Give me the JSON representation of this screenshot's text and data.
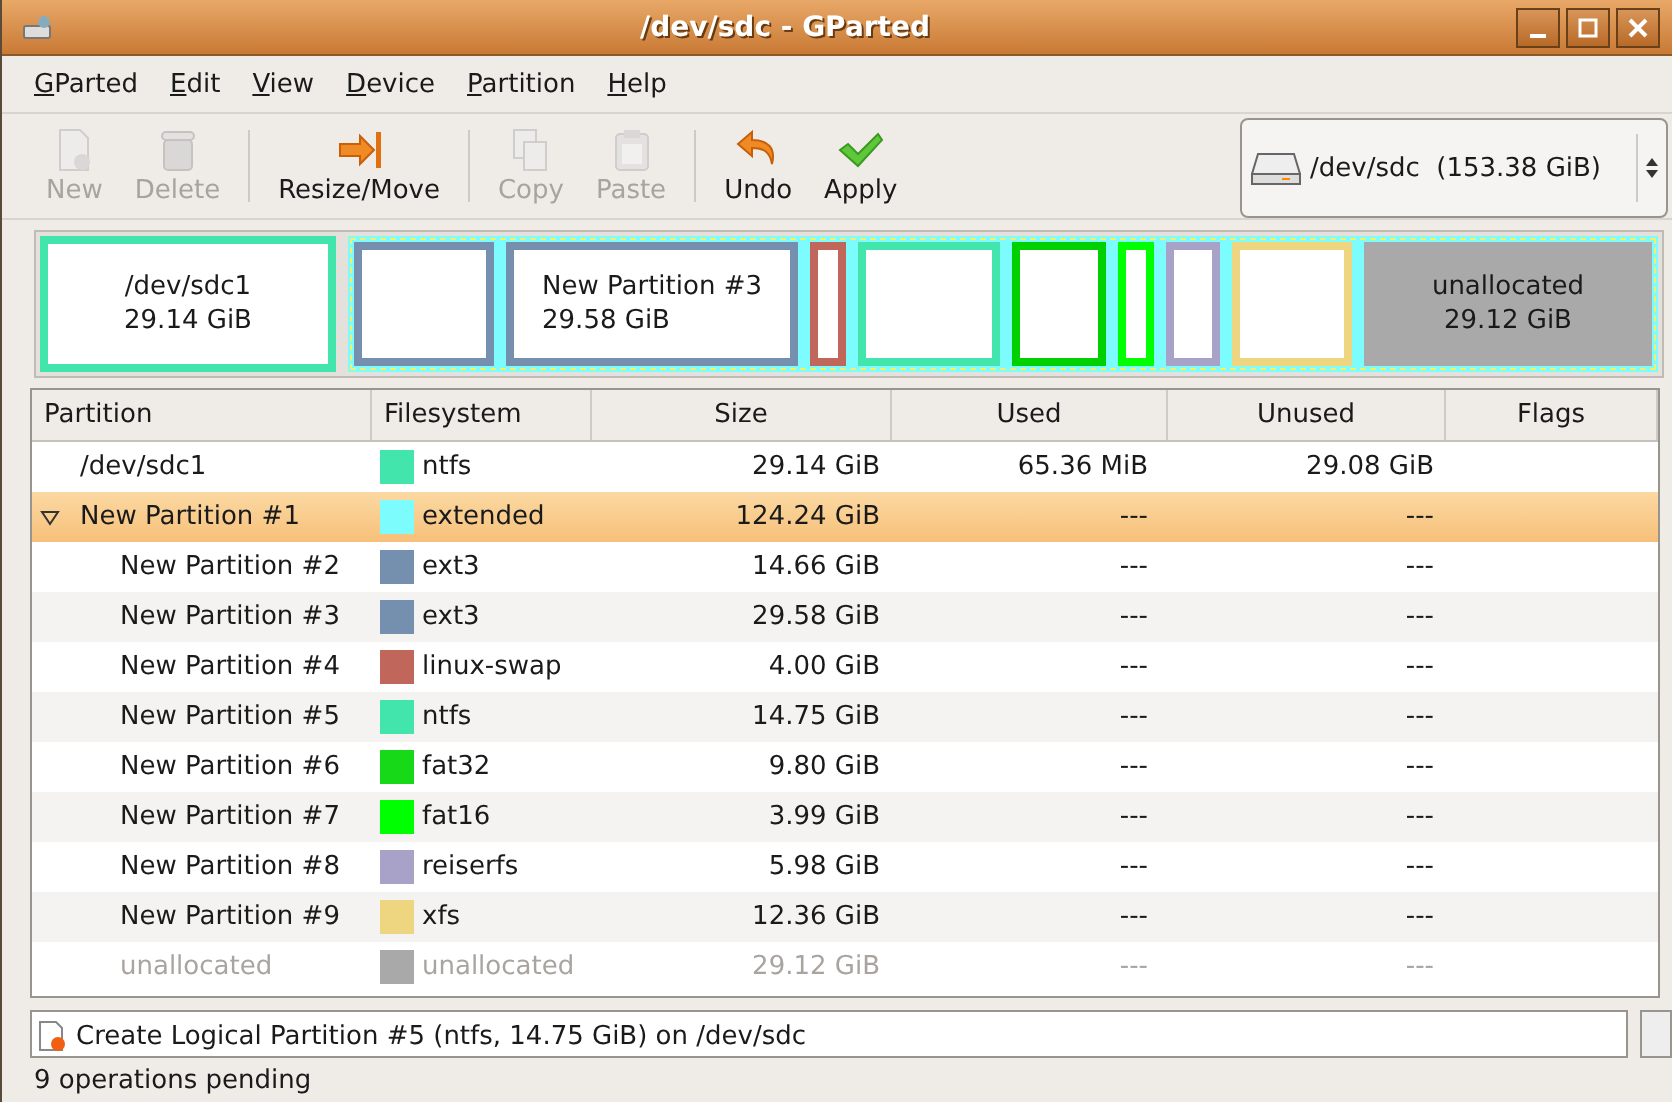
{
  "window": {
    "title": "/dev/sdc - GParted"
  },
  "menu": [
    "GParted",
    "Edit",
    "View",
    "Device",
    "Partition",
    "Help"
  ],
  "toolbar": [
    {
      "kind": "button",
      "label": "New",
      "disabled": true
    },
    {
      "kind": "button",
      "label": "Delete",
      "disabled": true
    },
    {
      "kind": "separator"
    },
    {
      "kind": "button",
      "label": "Resize/Move",
      "disabled": false
    },
    {
      "kind": "separator"
    },
    {
      "kind": "button",
      "label": "Copy",
      "disabled": true
    },
    {
      "kind": "button",
      "label": "Paste",
      "disabled": true
    },
    {
      "kind": "separator"
    },
    {
      "kind": "button",
      "label": "Undo",
      "disabled": false
    },
    {
      "kind": "button",
      "label": "Apply",
      "disabled": false
    }
  ],
  "device": {
    "name": "/dev/sdc",
    "size": "(153.38 GiB)"
  },
  "map": [
    {
      "kind": "partition",
      "label": "/dev/sdc1",
      "size": "29.14 GiB",
      "color": "#42e5ac"
    },
    {
      "kind": "extended",
      "color": "#7dfcfe",
      "children": [
        {
          "kind": "partition",
          "color": "#7590ae"
        },
        {
          "kind": "partition",
          "label": "New Partition #3",
          "size": "29.58 GiB",
          "color": "#7590ae"
        },
        {
          "kind": "partition",
          "color": "#c1665a"
        },
        {
          "kind": "partition",
          "color": "#42e5ac"
        },
        {
          "kind": "partition",
          "color": "#00d000"
        },
        {
          "kind": "partition",
          "color": "#00ff00"
        },
        {
          "kind": "partition",
          "color": "#a8a2c8"
        },
        {
          "kind": "partition",
          "color": "#eed680"
        },
        {
          "kind": "unallocated",
          "label": "unallocated",
          "size": "29.12 GiB",
          "color": "#a9a9a9"
        }
      ]
    }
  ],
  "table": {
    "columns": [
      "Partition",
      "Filesystem",
      "Size",
      "Used",
      "Unused",
      "Flags"
    ],
    "rows": [
      {
        "partition": "/dev/sdc1",
        "filesystem": "ntfs",
        "color": "#42e5ac",
        "size": "29.14 GiB",
        "used": "65.36 MiB",
        "unused": "29.08 GiB",
        "selected": false,
        "dimmed": false
      },
      {
        "partition": "New Partition #1",
        "filesystem": "extended",
        "color": "#7dfcfe",
        "size": "124.24 GiB",
        "used": "---",
        "unused": "---",
        "selected": true,
        "dimmed": false,
        "expanded": true,
        "children": [
          {
            "partition": "New Partition #2",
            "filesystem": "ext3",
            "color": "#7590ae",
            "size": "14.66 GiB",
            "used": "---",
            "unused": "---",
            "selected": false,
            "dimmed": false
          },
          {
            "partition": "New Partition #3",
            "filesystem": "ext3",
            "color": "#7590ae",
            "size": "29.58 GiB",
            "used": "---",
            "unused": "---",
            "selected": false,
            "dimmed": false
          },
          {
            "partition": "New Partition #4",
            "filesystem": "linux-swap",
            "color": "#c1665a",
            "size": "4.00 GiB",
            "used": "---",
            "unused": "---",
            "selected": false,
            "dimmed": false
          },
          {
            "partition": "New Partition #5",
            "filesystem": "ntfs",
            "color": "#42e5ac",
            "size": "14.75 GiB",
            "used": "---",
            "unused": "---",
            "selected": false,
            "dimmed": false
          },
          {
            "partition": "New Partition #6",
            "filesystem": "fat32",
            "color": "#18d918",
            "size": "9.80 GiB",
            "used": "---",
            "unused": "---",
            "selected": false,
            "dimmed": false
          },
          {
            "partition": "New Partition #7",
            "filesystem": "fat16",
            "color": "#00ff00",
            "size": "3.99 GiB",
            "used": "---",
            "unused": "---",
            "selected": false,
            "dimmed": false
          },
          {
            "partition": "New Partition #8",
            "filesystem": "reiserfs",
            "color": "#a8a2c8",
            "size": "5.98 GiB",
            "used": "---",
            "unused": "---",
            "selected": false,
            "dimmed": false
          },
          {
            "partition": "New Partition #9",
            "filesystem": "xfs",
            "color": "#eed680",
            "size": "12.36 GiB",
            "used": "---",
            "unused": "---",
            "selected": false,
            "dimmed": false
          },
          {
            "partition": "unallocated",
            "filesystem": "unallocated",
            "color": "#a9a9a9",
            "size": "29.12 GiB",
            "used": "---",
            "unused": "---",
            "selected": false,
            "dimmed": true
          }
        ]
      }
    ]
  },
  "operations": [
    "Create Logical Partition #5 (ntfs, 14.75 GiB) on /dev/sdc"
  ],
  "status_bar": "9 operations pending"
}
